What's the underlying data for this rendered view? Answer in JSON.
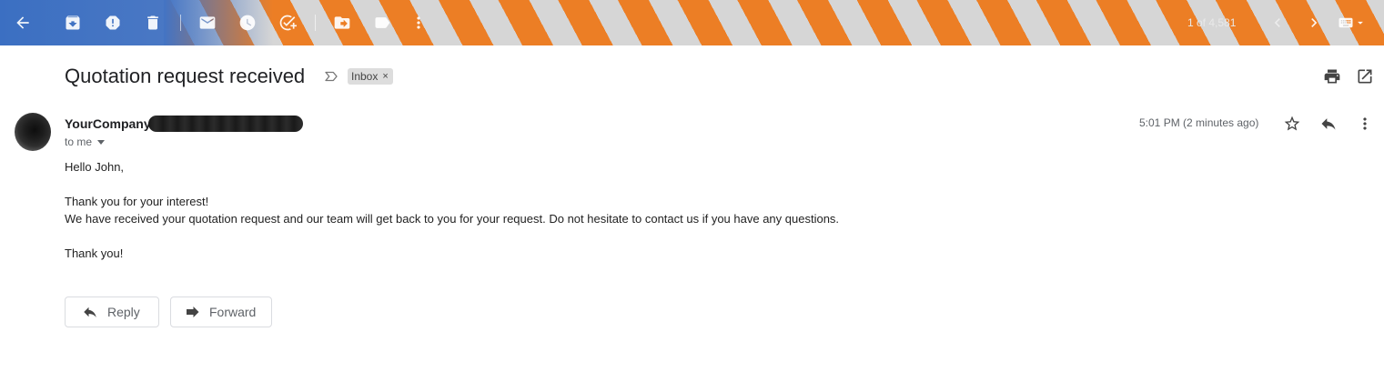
{
  "toolbar": {
    "pager_text": "1 of 4,581"
  },
  "message": {
    "subject": "Quotation request received",
    "label": "Inbox",
    "label_remove": "×",
    "sender_name": "YourCompany",
    "recipient_text": "to me",
    "timestamp": "5:01 PM (2 minutes ago)"
  },
  "body": {
    "greeting": "Hello John,",
    "line1": "Thank you for your interest!",
    "line2": "We have received your quotation request and our team will get back to you for your request. Do not hesitate to contact us if you have any questions.",
    "closing": "Thank you!"
  },
  "actions": {
    "reply_label": "Reply",
    "forward_label": "Forward"
  }
}
